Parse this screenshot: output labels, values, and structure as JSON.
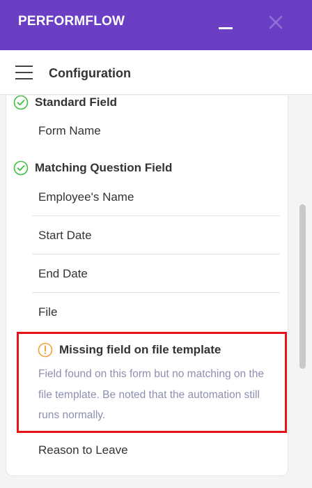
{
  "app": {
    "title": "PERFORMFLOW"
  },
  "toolbar": {
    "title": "Configuration"
  },
  "sections": {
    "standard": {
      "title": "Standard Field",
      "fields": [
        "Form Name"
      ]
    },
    "matching": {
      "title": "Matching Question Field",
      "fields": [
        "Employee's Name",
        "Start Date",
        "End Date",
        "File"
      ]
    }
  },
  "warning": {
    "title": "Missing field on file template",
    "description": "Field found on this form but no matching on the file template. Be noted that the automation still runs normally.",
    "fields": [
      "Reason to Leave"
    ]
  },
  "icons": {
    "check": "check-circle-icon",
    "warning": "exclamation-circle-icon",
    "menu": "hamburger-menu-icon",
    "minimize": "minimize-icon",
    "close": "close-icon"
  },
  "colors": {
    "brand": "#6b3fc3",
    "success": "#3fbf3f",
    "warning": "#f0a13a",
    "alert_border": "#e8131a",
    "muted_text": "#8d8fb0"
  }
}
